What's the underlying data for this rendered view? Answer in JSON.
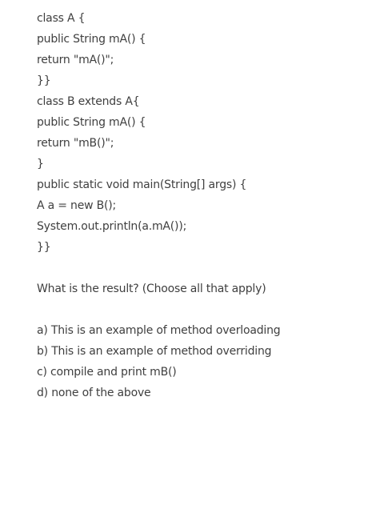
{
  "code_lines": [
    "class A {",
    "public String mA() {",
    "return \"mA()\";",
    "}}",
    "class B extends A{",
    "public String mA() {",
    "return \"mB()\";",
    "}",
    "public static void main(String[] args) {",
    "A a = new B();",
    "System.out.println(a.mA());",
    "}}"
  ],
  "question": "What is the result? (Choose all that apply)",
  "options": [
    "a) This is an example of method overloading",
    "b) This is an example of method overriding",
    "c) compile and print mB()",
    "d) none of the above"
  ]
}
